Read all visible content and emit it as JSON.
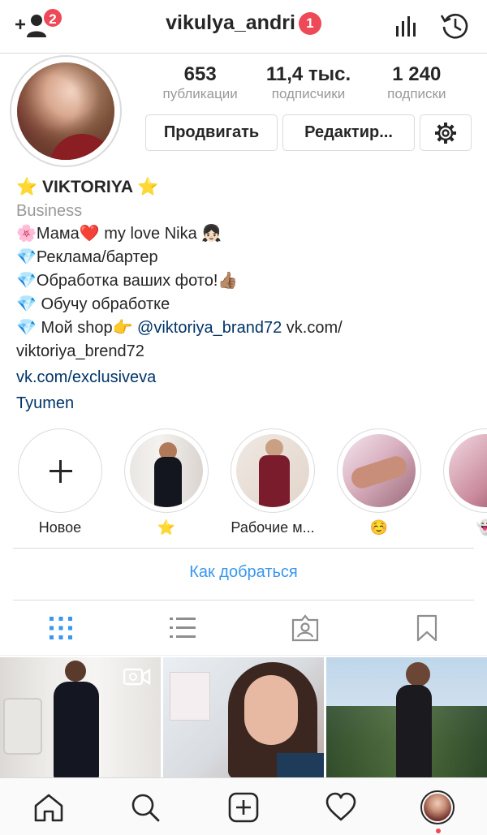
{
  "header": {
    "username": "vikulya_andri",
    "username_badge": "1",
    "notif_count": "2",
    "icons": [
      "add-user-icon",
      "stats-icon",
      "history-icon"
    ]
  },
  "profile": {
    "stats": [
      {
        "value": "653",
        "label": "публикации"
      },
      {
        "value": "11,4 тыс.",
        "label": "подписчики"
      },
      {
        "value": "1 240",
        "label": "подписки"
      }
    ],
    "promote_label": "Продвигать",
    "edit_label": "Редактир...",
    "settings_icon": "gear-icon"
  },
  "bio": {
    "name": "⭐ VIKTORIYA ⭐",
    "category": "Business",
    "lines": [
      "🌸Мама❤️ my love Nika 👧🏻",
      "💎Реклама/бартер",
      "💎Обработка ваших фото!👍🏽",
      "💎 Обучу обработке"
    ],
    "shop_prefix": "💎 Мой shop👉 ",
    "shop_mention": "@viktoriya_brand72",
    "shop_suffix": " vk.com/",
    "shop_cont": "viktoriya_brend72",
    "website": "vk.com/exclusiveva",
    "location": "Tyumen"
  },
  "highlights": [
    {
      "label": "Новое"
    },
    {
      "label": "⭐"
    },
    {
      "label": "Рабочие м..."
    },
    {
      "label": "☺️"
    },
    {
      "label": "👻"
    }
  ],
  "actions": {
    "directions": "Как добраться"
  },
  "tabs": [
    "grid-icon",
    "list-icon",
    "tagged-icon",
    "saved-icon"
  ],
  "bottom_nav": [
    "home-icon",
    "search-icon",
    "add-post-icon",
    "activity-icon",
    "profile-avatar"
  ],
  "colors": {
    "accent": "#3897f0",
    "badge": "#ed4956",
    "link": "#003569",
    "secondary_text": "#999999"
  }
}
